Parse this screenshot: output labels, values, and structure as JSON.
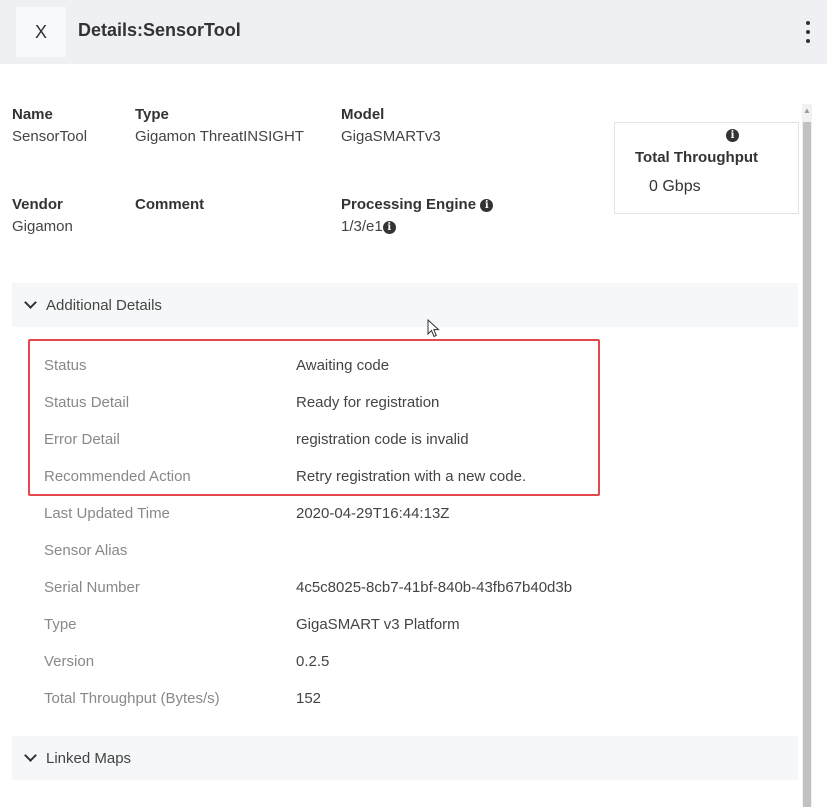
{
  "header": {
    "close_label": "X",
    "title": "Details:SensorTool"
  },
  "summary": {
    "name": {
      "label": "Name",
      "value": "SensorTool"
    },
    "type": {
      "label": "Type",
      "value": "Gigamon ThreatINSIGHT"
    },
    "model": {
      "label": "Model",
      "value": "GigaSMARTv3"
    },
    "vendor": {
      "label": "Vendor",
      "value": "Gigamon"
    },
    "comment": {
      "label": "Comment",
      "value": ""
    },
    "processing_engine": {
      "label": "Processing Engine",
      "value": "1/3/e1"
    }
  },
  "throughput_card": {
    "label": "Total Throughput",
    "value": "0 Gbps"
  },
  "additional_details": {
    "title": "Additional Details",
    "rows": [
      {
        "key": "Status",
        "value": "Awaiting code"
      },
      {
        "key": "Status Detail",
        "value": "Ready for registration"
      },
      {
        "key": "Error Detail",
        "value": "registration code is invalid"
      },
      {
        "key": "Recommended Action",
        "value": "Retry registration with a new code."
      },
      {
        "key": "Last Updated Time",
        "value": "2020-04-29T16:44:13Z"
      },
      {
        "key": "Sensor Alias",
        "value": ""
      },
      {
        "key": "Serial Number",
        "value": "4c5c8025-8cb7-41bf-840b-43fb67b40d3b"
      },
      {
        "key": "Type",
        "value": "GigaSMART v3 Platform"
      },
      {
        "key": "Version",
        "value": "0.2.5"
      },
      {
        "key": "Total Throughput (Bytes/s)",
        "value": "152"
      }
    ]
  },
  "linked_maps": {
    "title": "Linked Maps"
  },
  "colors": {
    "highlight": "#e4474d",
    "header_bg": "#eef0f3"
  }
}
